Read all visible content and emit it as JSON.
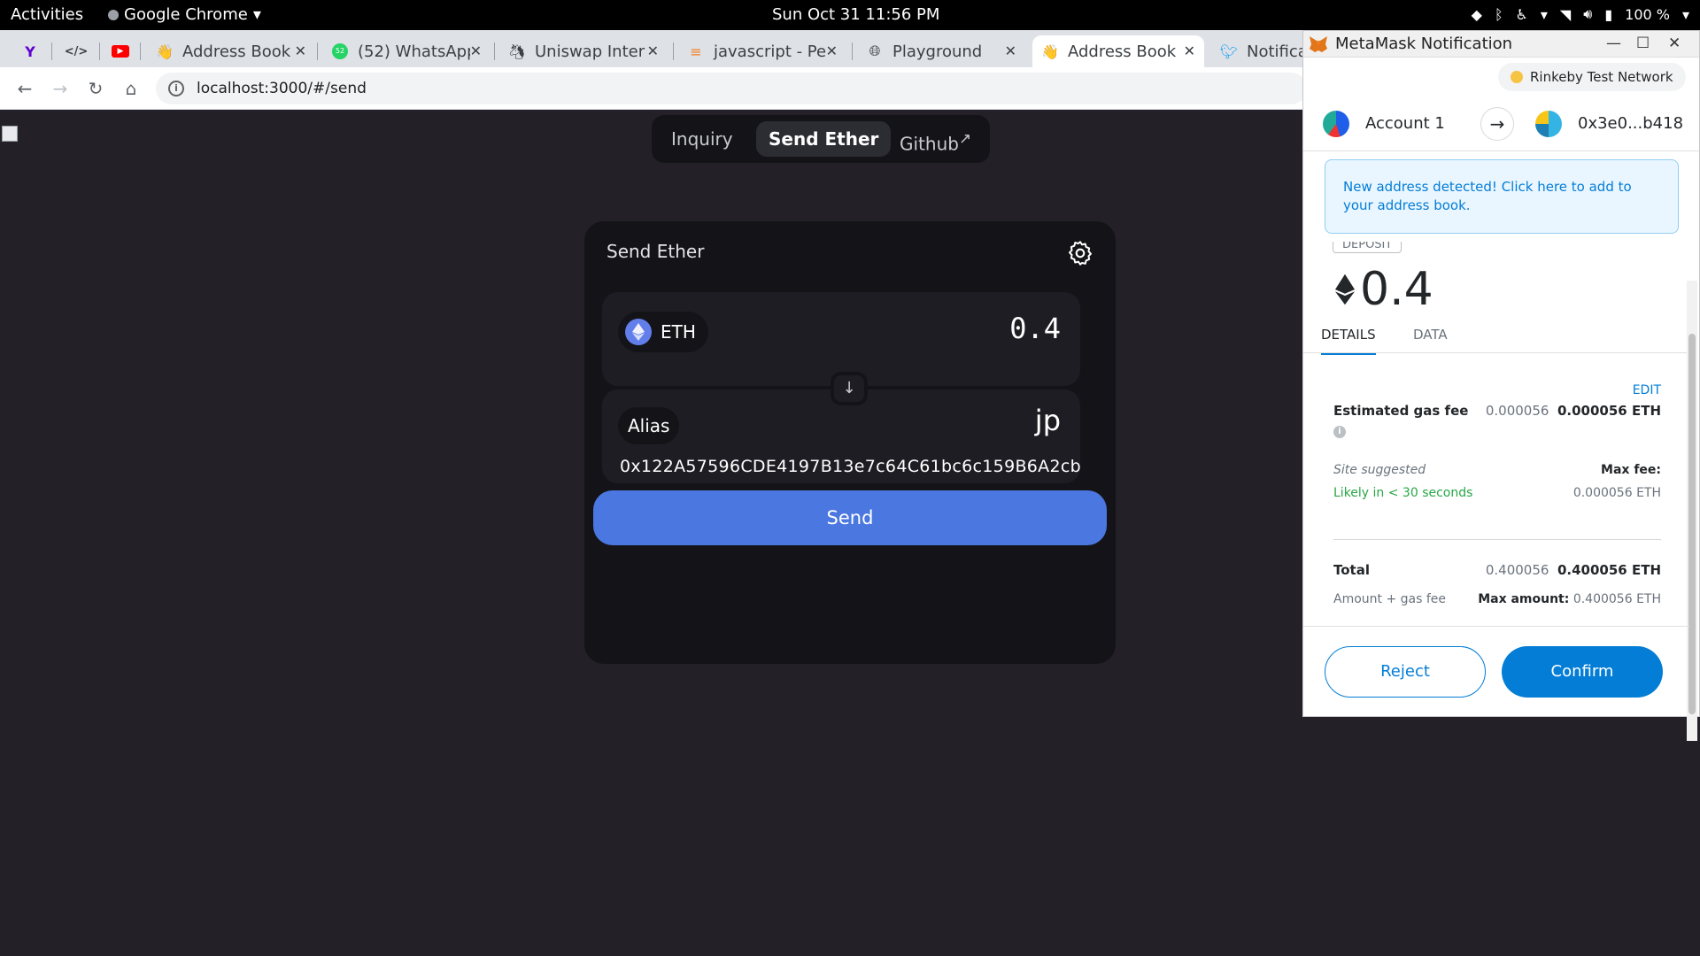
{
  "system_bar": {
    "activities": "Activities",
    "app_name": "Google Chrome",
    "clock": "Sun Oct 31  11:56 PM",
    "battery": "100 %"
  },
  "tabs": [
    {
      "label": "",
      "icon": "yahoo-icon"
    },
    {
      "label": "",
      "icon": "code-icon"
    },
    {
      "label": "",
      "icon": "youtube-icon"
    },
    {
      "label": "Address Book",
      "icon": "wave-icon"
    },
    {
      "label": "(52) WhatsApp",
      "icon": "whatsapp-icon"
    },
    {
      "label": "Uniswap Inter",
      "icon": "uniswap-icon"
    },
    {
      "label": "javascript - Pe",
      "icon": "stackoverflow-icon"
    },
    {
      "label": "Playground",
      "icon": "globe-icon"
    },
    {
      "label": "Address Book",
      "icon": "wave-icon",
      "active": true
    },
    {
      "label": "Notifica",
      "icon": "twitter-icon"
    }
  ],
  "address_bar": {
    "url": "localhost:3000/#/send"
  },
  "app_nav": {
    "items": [
      "Inquiry",
      "Send Ether",
      "Github"
    ],
    "github_suffix": "↗",
    "active": "Send Ether"
  },
  "send_card": {
    "title": "Send Ether",
    "token": "ETH",
    "amount": "0.4",
    "alias_label": "Alias",
    "alias_value": "jp",
    "address": "0x122A57596CDE4197B13e7c64C61bc6c159B6A2cb",
    "send_label": "Send"
  },
  "metamask": {
    "window_title": "MetaMask Notification",
    "network": "Rinkeby Test Network",
    "from_account": "Account 1",
    "to_address": "0x3e0...b418",
    "alert": "New address detected! Click here to add to your address book.",
    "deposit_badge": "DEPOSIT",
    "value": "0.4",
    "tabs": [
      "DETAILS",
      "DATA"
    ],
    "edit": "EDIT",
    "gas_label": "Estimated gas fee",
    "gas_value": "0.000056",
    "gas_value_eth": "0.000056 ETH",
    "site_suggested": "Site suggested",
    "likely": "Likely in < 30 seconds",
    "max_fee_label": "Max fee:",
    "max_fee_value": "0.000056 ETH",
    "total_label": "Total",
    "total_value": "0.400056",
    "total_value_eth": "0.400056 ETH",
    "amount_gas_label": "Amount + gas fee",
    "max_amount_label": "Max amount:",
    "max_amount_value": "0.400056 ETH",
    "reject": "Reject",
    "confirm": "Confirm"
  },
  "colors": {
    "accent_blue": "#4a77e0",
    "metamask_blue": "#037dd6",
    "page_bg": "#232127"
  }
}
